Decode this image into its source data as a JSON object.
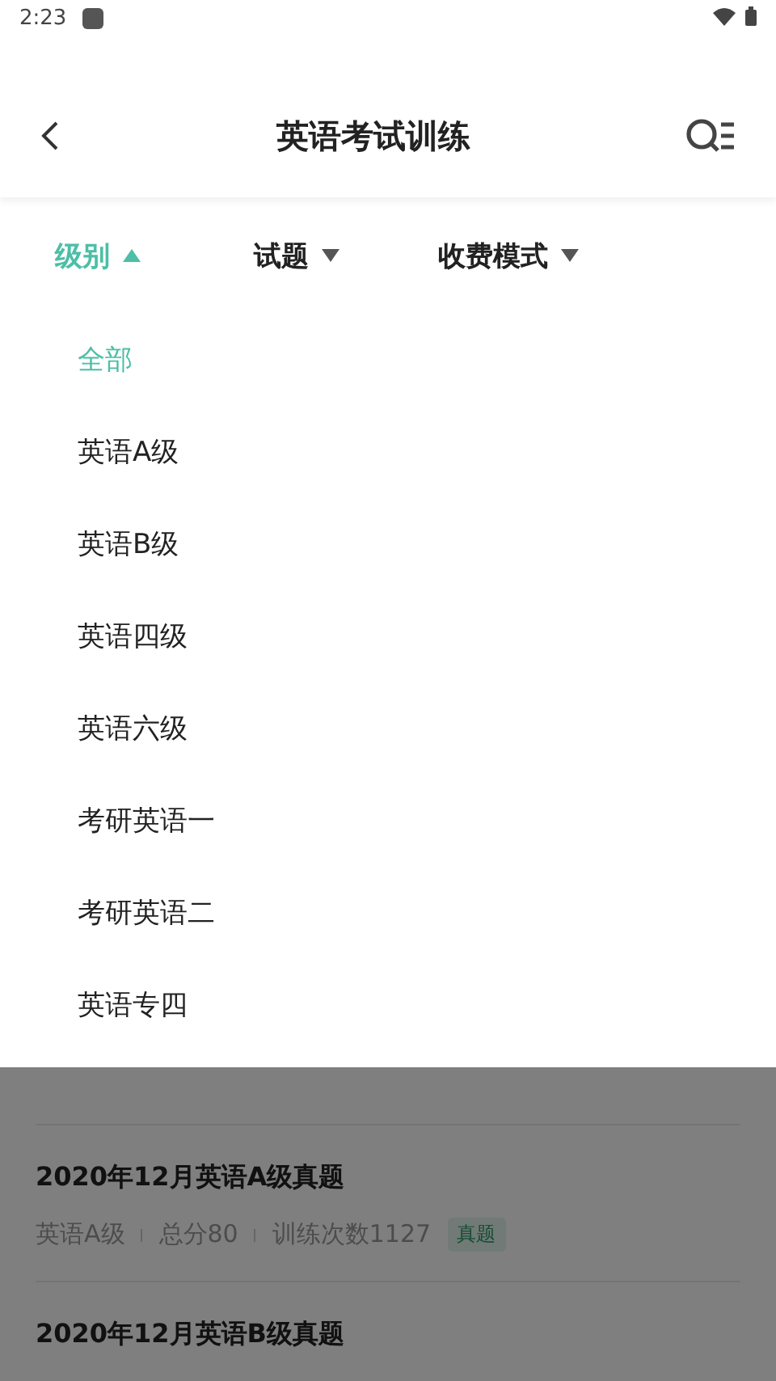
{
  "status_bar": {
    "time": "2:23"
  },
  "header": {
    "title": "英语考试训练"
  },
  "filters": [
    {
      "label": "级别",
      "selected": true
    },
    {
      "label": "试题",
      "selected": false
    },
    {
      "label": "收费模式",
      "selected": false
    }
  ],
  "dropdown": {
    "options": [
      {
        "label": "全部",
        "selected": true
      },
      {
        "label": "英语A级",
        "selected": false
      },
      {
        "label": "英语B级",
        "selected": false
      },
      {
        "label": "英语四级",
        "selected": false
      },
      {
        "label": "英语六级",
        "selected": false
      },
      {
        "label": "考研英语一",
        "selected": false
      },
      {
        "label": "考研英语二",
        "selected": false
      },
      {
        "label": "英语专四",
        "selected": false
      }
    ]
  },
  "papers": [
    {
      "title": "2020年12月英语A级真题",
      "level": "英语A级",
      "score": "总分80",
      "count": "训练次数1127",
      "tag": "真题"
    },
    {
      "title": "2020年12月英语B级真题"
    }
  ]
}
